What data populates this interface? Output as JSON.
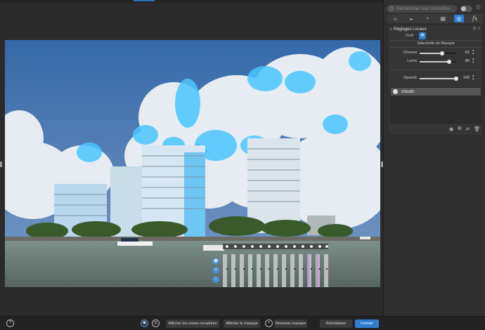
{
  "search": {
    "placeholder": "Rechercher une correction"
  },
  "toolbar_icons": [
    "light-icon",
    "color-icon",
    "detail-icon",
    "geometry-icon",
    "local-adjust-icon",
    "fx-icon"
  ],
  "section": {
    "title": "Réglages Locaux",
    "outil_label": "Outil",
    "subheading": "Sélectivité du Masque",
    "sliders": [
      {
        "label": "Chroma",
        "value": "62",
        "percent": 62
      },
      {
        "label": "Luma",
        "value": "80",
        "percent": 80
      },
      {
        "label": "Opacité",
        "value": "100",
        "percent": 100
      }
    ],
    "mask_items": [
      {
        "label": "clouds"
      }
    ]
  },
  "bottom": {
    "show_cropped": "Afficher les zones recadrées",
    "show_mask": "Afficher le masque",
    "new_mask": "Nouveau masque",
    "reset": "Réinitialiser",
    "close": "Fermer"
  },
  "colors": {
    "accent": "#2f7dd1",
    "mask": "#4cc6ff"
  }
}
